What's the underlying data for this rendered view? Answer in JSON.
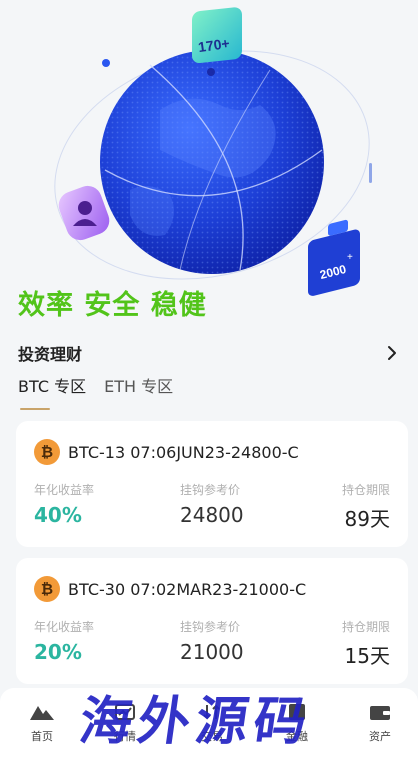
{
  "hero": {
    "badge_top": "170+",
    "badge_right": "2000"
  },
  "slogan": "效率 安全 稳健",
  "section": {
    "title": "投资理财"
  },
  "tabs": [
    {
      "label": "BTC 专区",
      "active": true
    },
    {
      "label": "ETH 专区",
      "active": false
    }
  ],
  "cards": [
    {
      "name": "BTC-13 07:06JUN23-24800-C",
      "labels": {
        "rate": "年化收益率",
        "price": "挂钩参考价",
        "term": "持仓期限"
      },
      "rate": "40%",
      "price": "24800",
      "term": "89天"
    },
    {
      "name": "BTC-30 07:02MAR23-21000-C",
      "labels": {
        "rate": "年化收益率",
        "price": "挂钩参考价",
        "term": "持仓期限"
      },
      "rate": "20%",
      "price": "21000",
      "term": "15天"
    }
  ],
  "nav": [
    {
      "label": "首页",
      "icon": "home-icon"
    },
    {
      "label": "行情",
      "icon": "market-icon"
    },
    {
      "label": "交易",
      "icon": "trade-icon"
    },
    {
      "label": "金融",
      "icon": "finance-icon"
    },
    {
      "label": "资产",
      "icon": "wallet-icon"
    }
  ],
  "watermark": "海外源码",
  "colors": {
    "accent_green": "#52c41a",
    "rate_teal": "#2bb5a0",
    "globe_blue": "#1e3fd8",
    "watermark_blue": "#2323c4",
    "btc_orange": "#f29a38"
  }
}
